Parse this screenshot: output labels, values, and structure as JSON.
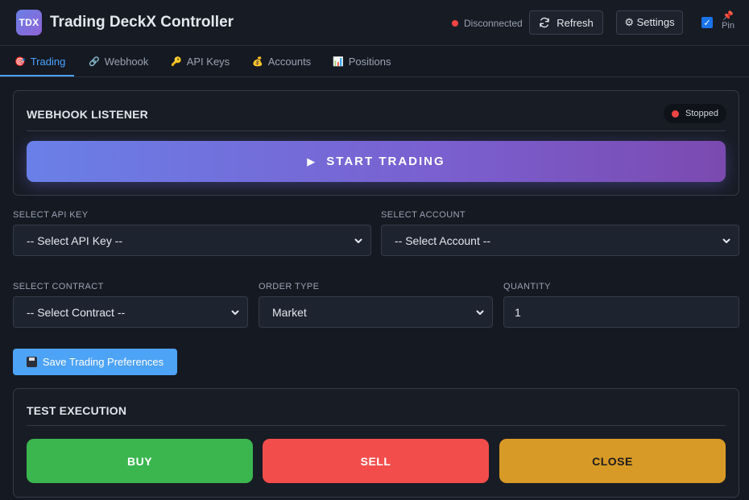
{
  "app": {
    "logo_text": "TDX",
    "title": "Trading DeckX Controller"
  },
  "header": {
    "connection_status": "Disconnected",
    "connection_color": "#ef4444",
    "refresh_label": "Refresh",
    "settings_label": "⚙ Settings",
    "pin_label": "Pin",
    "pin_checked": true
  },
  "tabs": [
    {
      "icon": "🎯",
      "label": "Trading",
      "active": true
    },
    {
      "icon": "🔗",
      "label": "Webhook",
      "active": false
    },
    {
      "icon": "🔑",
      "label": "API Keys",
      "active": false
    },
    {
      "icon": "💰",
      "label": "Accounts",
      "active": false
    },
    {
      "icon": "📊",
      "label": "Positions",
      "active": false
    }
  ],
  "webhook": {
    "title": "WEBHOOK LISTENER",
    "status": "Stopped",
    "status_color": "#ef4444",
    "start_label": "START TRADING"
  },
  "form": {
    "api_key_label": "SELECT API KEY",
    "api_key_value": "-- Select API Key --",
    "account_label": "SELECT ACCOUNT",
    "account_value": "-- Select Account --",
    "contract_label": "SELECT CONTRACT",
    "contract_value": "-- Select Contract --",
    "order_type_label": "ORDER TYPE",
    "order_type_value": "Market",
    "quantity_label": "QUANTITY",
    "quantity_value": "1",
    "save_label": "Save Trading Preferences"
  },
  "test": {
    "title": "TEST EXECUTION",
    "buy_label": "BUY",
    "sell_label": "SELL",
    "close_label": "CLOSE"
  },
  "colors": {
    "accent": "#4aa3ff",
    "buy": "#3bb64f",
    "sell": "#f24d4b",
    "close": "#d89a26"
  }
}
